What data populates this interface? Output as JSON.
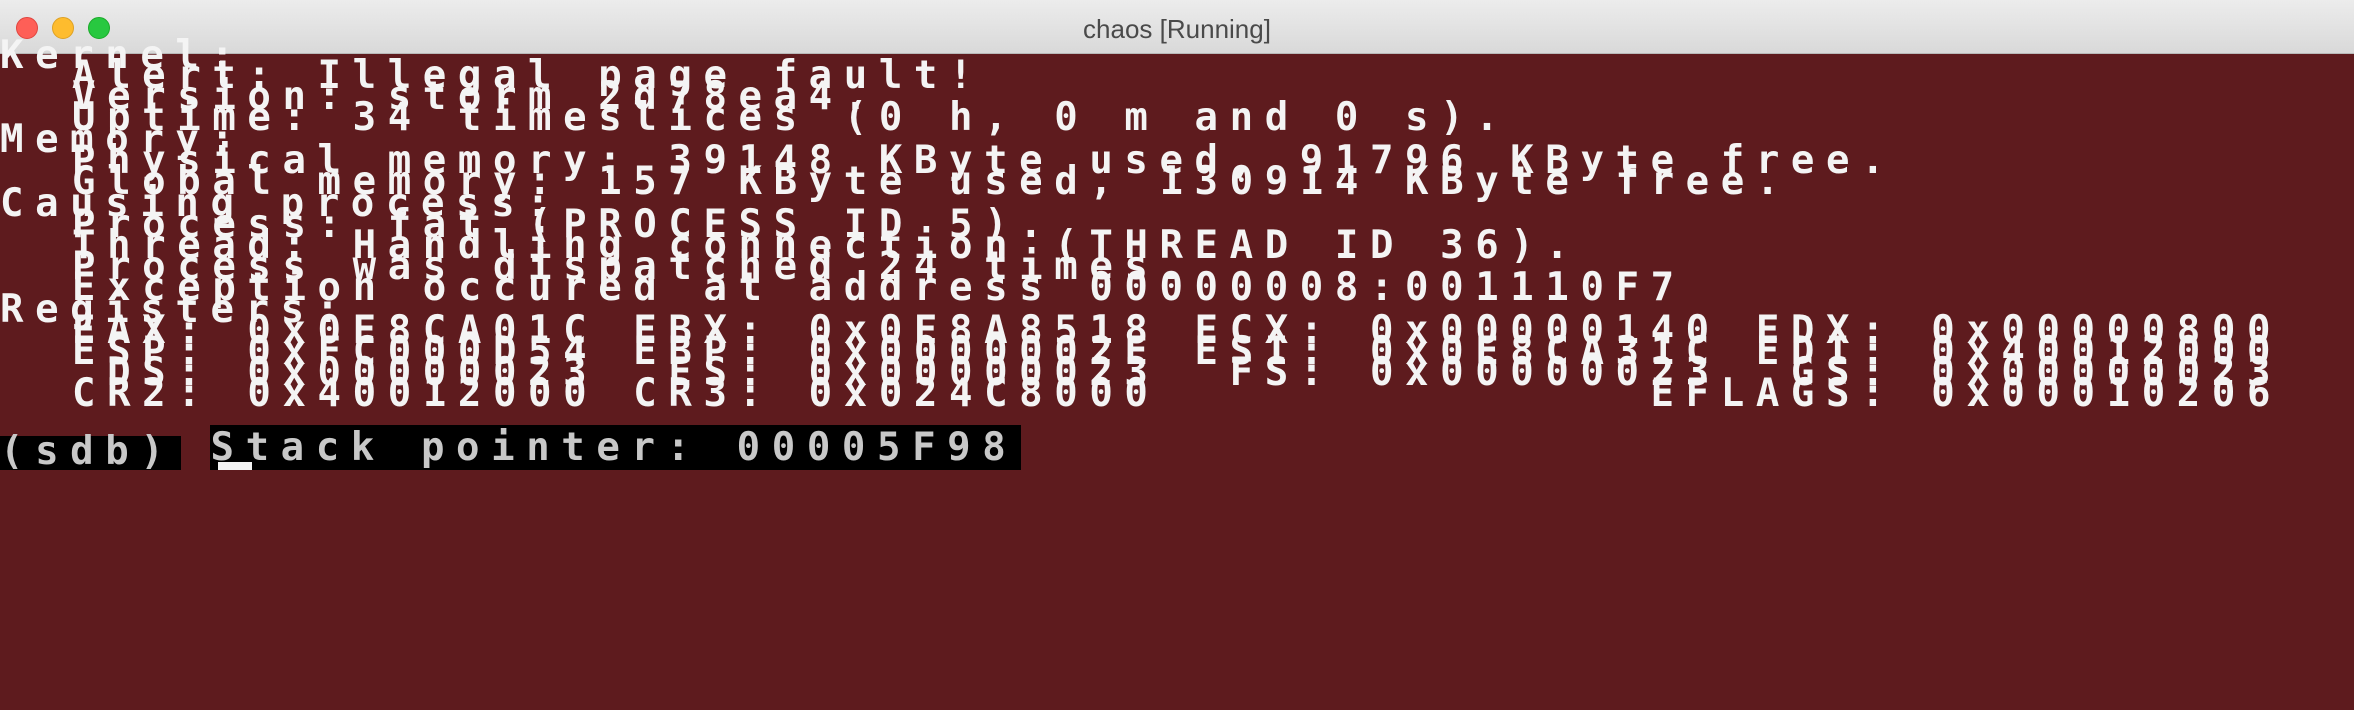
{
  "window": {
    "title": "chaos [Running]"
  },
  "terminal": {
    "lines": [
      "Kernel:",
      "Alert: Illegal page fault!",
      "Version: storm 2d78ea4.",
      "Uptime: 34 timeslices (0 h, 0 m and 0 s).",
      "Memory:",
      "Physical memory: 39148 KByte used, 91796 KByte free.",
      "Global memory: 157 KByte used, 130914 KByte free.",
      "Causing process:",
      "Process: fat (PROCESS ID 5).",
      "Thread: Handling connection (THREAD ID 36).",
      "Process was dispatched 24 times.",
      "Exception occured at address 00000008:001110F7",
      "Registers:",
      "EAX: 0x0E8CA01C EBX: 0x0E8A8518 ECX: 0x00000140 EDX: 0x00000800",
      "ESP: 0xFC000D54 EBP: 0x0000002E ESI: 0x0E8CA31C EDI: 0x40012000",
      " DS: 0x00000023  ES: 0x00000023  FS: 0x00000023  GS: 0x00000023",
      "CR2: 0x40012000 CR3: 0x024C8000              EFLAGS: 0x00010206",
      "Stack pointer: 00005F98"
    ],
    "prompt": "(sdb)"
  },
  "colors": {
    "background": "#5e1b1e",
    "text": "#f4f4f4",
    "highlight_bg": "#000000",
    "highlight_text": "#c8c8c8"
  }
}
